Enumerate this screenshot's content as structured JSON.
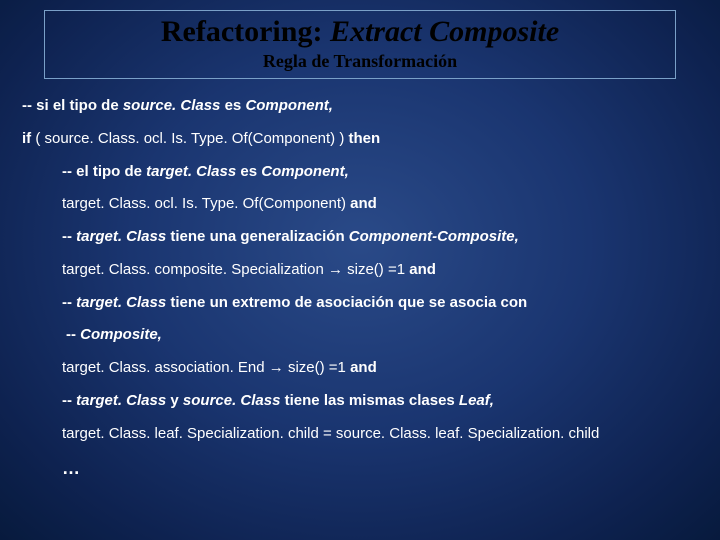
{
  "header": {
    "title_plain": "Refactoring: ",
    "title_italic": "Extract Composite",
    "subtitle": "Regla de Transformación"
  },
  "lines": {
    "l1a": "-- si el tipo de ",
    "l1b": "source. Class",
    "l1c": " es ",
    "l1d": "Component,",
    "l2a": "if",
    "l2b": "  ( source. Class. ocl. Is. Type. Of(Component) ) ",
    "l2c": "then",
    "l3a": "-- el tipo de ",
    "l3b": "target. Class",
    "l3c": " es ",
    "l3d": "Component,",
    "l4a": "target. Class. ocl. Is. Type. Of(Component)  ",
    "l4b": "and",
    "l5a": "-- ",
    "l5b": "target. Class",
    "l5c": " tiene una generalización ",
    "l5d": "Component-Composite,",
    "l6a": "target. Class. composite. Specialization ",
    "l6arrow": "→",
    "l6b": " size() =1 ",
    "l6c": "and",
    "l7a": "-- ",
    "l7b": "target. Class",
    "l7c": " tiene un extremo de asociación que se asocia con",
    "l8a": "-- ",
    "l8b": "Composite,",
    "l9a": "target. Class. association. End ",
    "l9arrow": "→",
    "l9b": " size() =1  ",
    "l9c": "and",
    "l10a": "-- ",
    "l10b": "target. Class",
    "l10c": " y ",
    "l10d": "source. Class",
    "l10e": " tiene las mismas clases ",
    "l10f": "Leaf,",
    "l11": "target. Class. leaf. Specialization. child = source. Class. leaf. Specialization. child",
    "dots": "…"
  }
}
